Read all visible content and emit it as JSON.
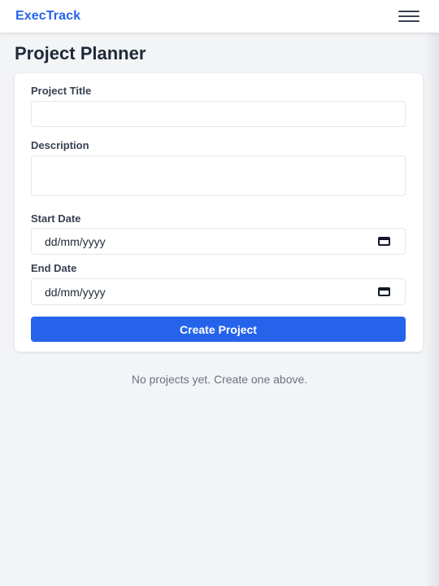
{
  "header": {
    "brand": "ExecTrack",
    "menu_icon": "hamburger-menu-icon"
  },
  "page": {
    "title": "Project Planner"
  },
  "form": {
    "title_label": "Project Title",
    "title_value": "",
    "description_label": "Description",
    "description_value": "",
    "start_label": "Start Date",
    "start_placeholder": "dd/mm/yyyy",
    "end_label": "End Date",
    "end_placeholder": "dd/mm/yyyy",
    "calendar_icon": "calendar-icon",
    "submit_label": "Create Project"
  },
  "projects": {
    "empty_message": "No projects yet. Create one above."
  },
  "colors": {
    "accent": "#2563eb",
    "background": "#f3f4f6"
  }
}
